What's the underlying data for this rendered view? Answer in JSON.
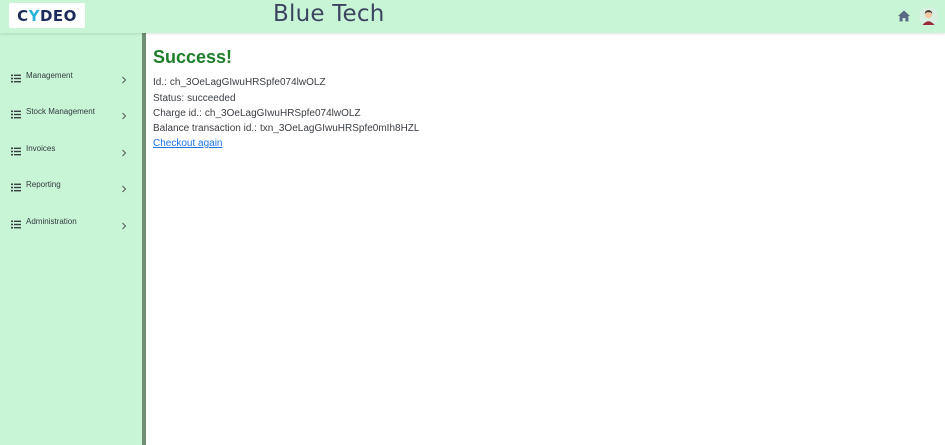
{
  "header": {
    "logo": {
      "part1": "C",
      "accent": "Y",
      "part2": "DEO"
    },
    "title": "Blue Tech",
    "home_icon": "home-icon",
    "avatar_icon": "user-avatar"
  },
  "sidebar": {
    "items": [
      {
        "label": "Management",
        "icon": "list-icon"
      },
      {
        "label": "Stock Management",
        "icon": "list-icon"
      },
      {
        "label": "Invoices",
        "icon": "list-icon"
      },
      {
        "label": "Reporting",
        "icon": "list-icon"
      },
      {
        "label": "Administration",
        "icon": "list-icon"
      }
    ]
  },
  "main": {
    "title": "Success!",
    "fields": [
      {
        "label": "Id.:",
        "value": "ch_3OeLagGIwuHRSpfe074lwOLZ"
      },
      {
        "label": "Status:",
        "value": "succeeded"
      },
      {
        "label": "Charge id.:",
        "value": "ch_3OeLagGIwuHRSpfe074lwOLZ"
      },
      {
        "label": "Balance transaction id.:",
        "value": "txn_3OeLagGIwuHRSpfe0mIh8HZL"
      }
    ],
    "checkout_link": "Checkout again"
  },
  "colors": {
    "header_bg": "#c8f5d6",
    "sidebar_bg": "#c8f5d6",
    "success": "#1e7e2a",
    "link": "#1a73e8",
    "logo_dark": "#1c2b59",
    "logo_accent": "#28b4d8"
  }
}
